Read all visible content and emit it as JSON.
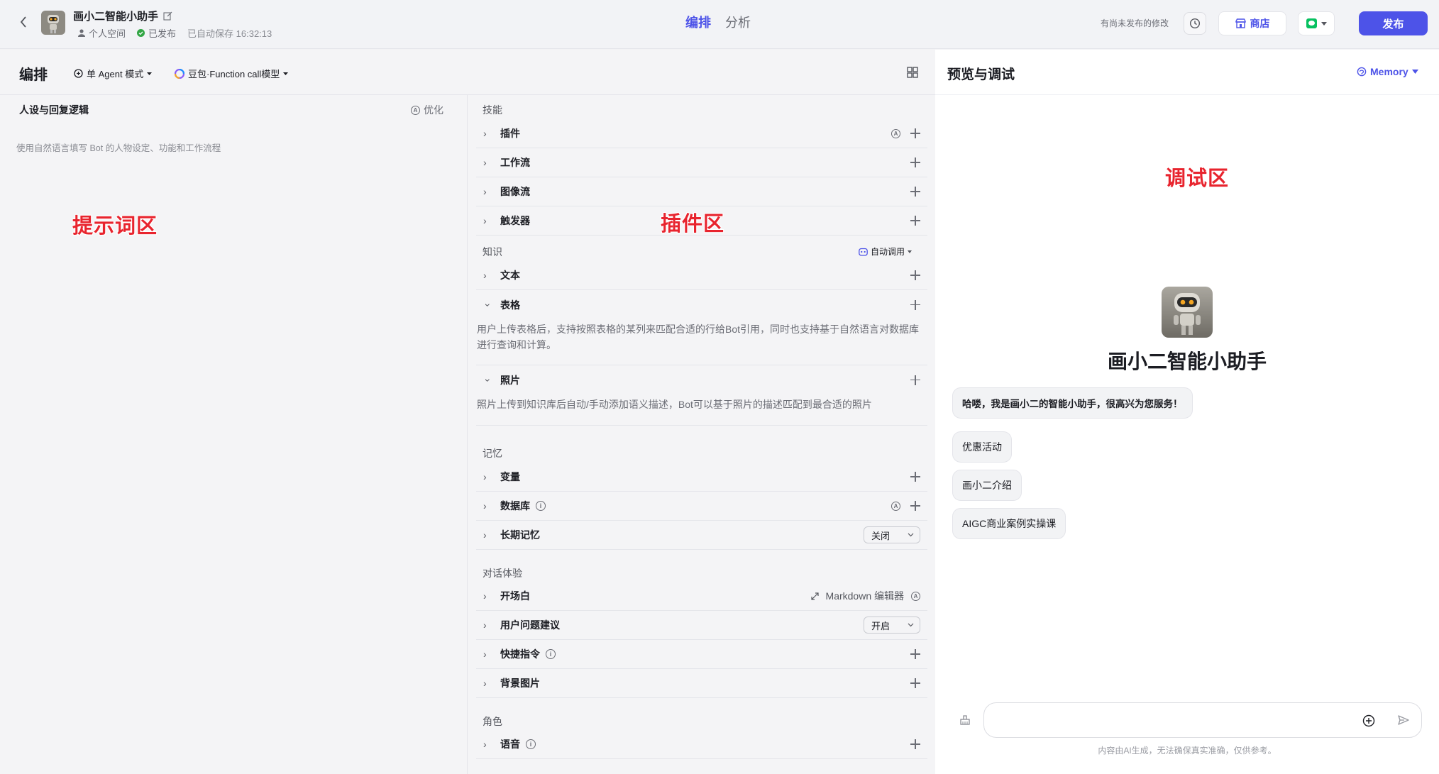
{
  "header": {
    "bot_name": "画小二智能小助手",
    "space": "个人空间",
    "status": "已发布",
    "autosave": "已自动保存 16:32:13",
    "tabs": [
      {
        "label": "编排",
        "active": true
      },
      {
        "label": "分析",
        "active": false
      }
    ],
    "unpublished_notice": "有尚未发布的修改",
    "store_label": "商店",
    "publish_label": "发布",
    "accent_color": "#4d53e8"
  },
  "edit": {
    "title": "编排",
    "mode": "单 Agent 模式",
    "model": "豆包·Function call模型"
  },
  "prompt": {
    "title": "人设与回复逻辑",
    "optimize_label": "优化",
    "placeholder": "使用自然语言填写 Bot 的人物设定、功能和工作流程",
    "overlay": "提示词区"
  },
  "skills": {
    "overlay": "插件区",
    "sections": {
      "skill": "技能",
      "knowledge": "知识",
      "memory": "记忆",
      "dialog": "对话体验",
      "role": "角色"
    },
    "skill_items": [
      "插件",
      "工作流",
      "图像流",
      "触发器"
    ],
    "knowledge_auto": "自动调用",
    "knowledge_items": {
      "text": "文本",
      "table": "表格",
      "table_desc": "用户上传表格后，支持按照表格的某列来匹配合适的行给Bot引用，同时也支持基于自然语言对数据库进行查询和计算。",
      "photo": "照片",
      "photo_desc": "照片上传到知识库后自动/手动添加语义描述，Bot可以基于照片的描述匹配到最合适的照片"
    },
    "memory_items": {
      "variable": "变量",
      "database": "数据库",
      "long_term": "长期记忆",
      "long_term_value": "关闭"
    },
    "dialog_items": {
      "opening": "开场白",
      "markdown": "Markdown 编辑器",
      "suggest": "用户问题建议",
      "suggest_value": "开启",
      "shortcut": "快捷指令",
      "background": "背景图片"
    },
    "role_items": {
      "voice": "语音"
    }
  },
  "preview": {
    "title": "预览与调试",
    "memory_label": "Memory",
    "overlay": "调试区",
    "bot_name": "画小二智能小助手",
    "greeting": "哈喽，我是画小二的智能小助手，很高兴为您服务！",
    "suggestions": [
      "优惠活动",
      "画小二介绍",
      "AIGC商业案例实操课"
    ],
    "footnote": "内容由AI生成，无法确保真实准确，仅供参考。"
  }
}
